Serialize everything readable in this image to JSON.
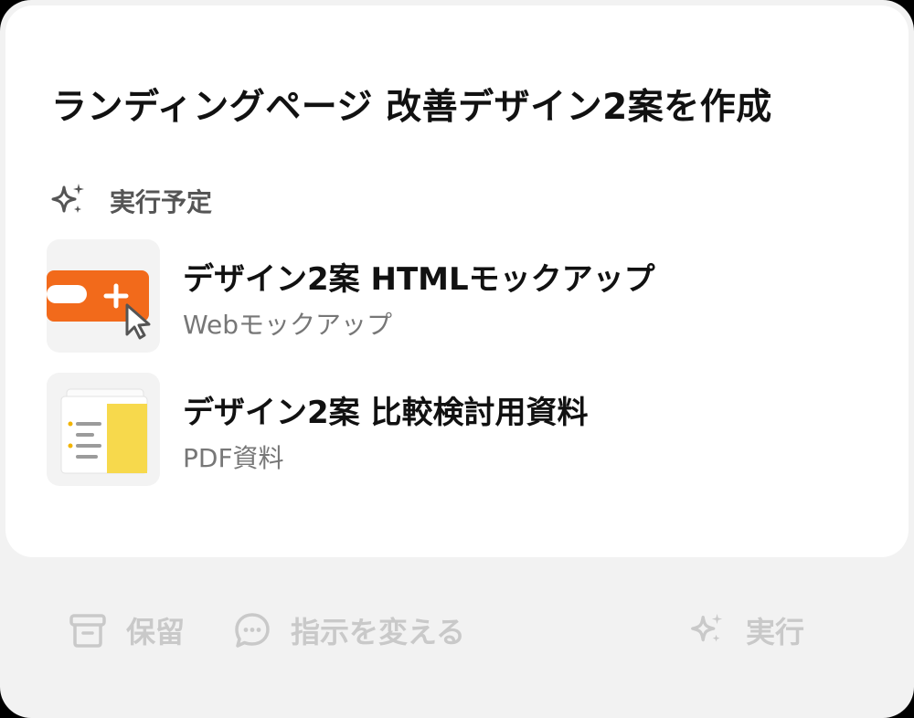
{
  "card": {
    "title": "ランディングページ 改善デザイン2案を作成",
    "section_label": "実行予定"
  },
  "items": [
    {
      "title": "デザイン2案 HTMLモックアップ",
      "subtitle": "Webモックアップ",
      "icon": "web-mockup-thumbnail"
    },
    {
      "title": "デザイン2案 比較検討用資料",
      "subtitle": "PDF資料",
      "icon": "pdf-document-thumbnail"
    }
  ],
  "footer": {
    "hold_label": "保留",
    "change_label": "指示を変える",
    "run_label": "実行"
  },
  "colors": {
    "accent_orange": "#f26a1b",
    "doc_yellow": "#f7d94c",
    "disabled_text": "#c9c9c9"
  }
}
